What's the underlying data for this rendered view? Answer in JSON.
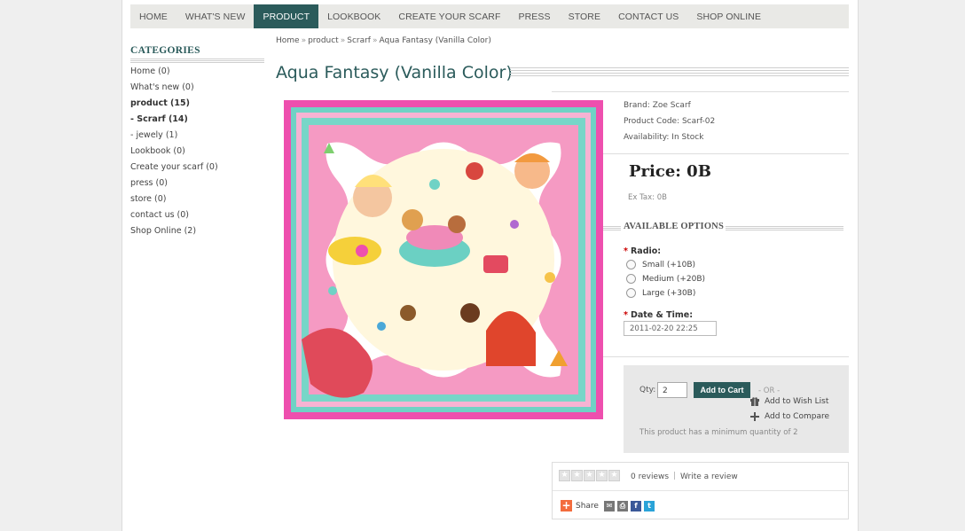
{
  "nav": {
    "items": [
      "HOME",
      "WHAT'S NEW",
      "PRODUCT",
      "LOOKBOOK",
      "CREATE YOUR SCARF",
      "PRESS",
      "STORE",
      "CONTACT US",
      "SHOP ONLINE"
    ],
    "active": "PRODUCT"
  },
  "sidebar": {
    "heading": "CATEGORIES",
    "items": [
      {
        "label": "Home (0)",
        "bold": false
      },
      {
        "label": "What's new (0)",
        "bold": false
      },
      {
        "label": "product (15)",
        "bold": true
      },
      {
        "label": "- Scrarf (14)",
        "bold": true
      },
      {
        "label": "- jewely (1)",
        "bold": false
      },
      {
        "label": "Lookbook (0)",
        "bold": false
      },
      {
        "label": "Create your scarf (0)",
        "bold": false
      },
      {
        "label": "press (0)",
        "bold": false
      },
      {
        "label": "store (0)",
        "bold": false
      },
      {
        "label": "contact us (0)",
        "bold": false
      },
      {
        "label": "Shop Online (2)",
        "bold": false
      }
    ]
  },
  "breadcrumb": [
    "Home",
    "product",
    "Scrarf",
    "Aqua Fantasy (Vanilla Color)"
  ],
  "breadcrumb_sep": "»",
  "product": {
    "title": "Aqua Fantasy (Vanilla Color)",
    "brand": "Brand: Zoe Scarf",
    "code": "Product Code: Scarf-02",
    "availability": "Availability: In Stock",
    "price": "Price: 0B",
    "ex_tax": "Ex Tax: 0B"
  },
  "options": {
    "heading": "AVAILABLE OPTIONS",
    "radio_label": "Radio:",
    "radio_options": [
      "Small (+10B)",
      "Medium (+20B)",
      "Large (+30B)"
    ],
    "datetime_label": "Date & Time:",
    "datetime_value": "2011-02-20 22:25",
    "required_mark": "*"
  },
  "cart": {
    "qty_label": "Qty:",
    "qty_value": "2",
    "add_button": "Add to Cart",
    "or_text": "- OR -",
    "wishlist": "Add to Wish List",
    "compare": "Add to Compare",
    "min_note": "This product has a minimum quantity of 2"
  },
  "review": {
    "count": "0 reviews",
    "separator": "|",
    "write": "Write a review",
    "share": "Share"
  },
  "colors": {
    "brand": "#2b5b5b",
    "frame_pink": "#ee4fae",
    "frame_aqua": "#6fd2c5"
  }
}
